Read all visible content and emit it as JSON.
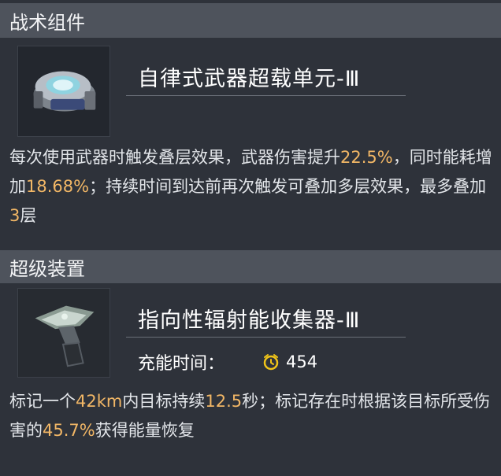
{
  "tactical": {
    "header": "战术组件",
    "item_name": "自律式武器超载单元-Ⅲ",
    "icon": "overload-unit-icon",
    "desc": {
      "p1": "每次使用武器时触发叠层效果，武器伤害提升",
      "v1": "22.5%",
      "p2": "，同时能耗增加",
      "v2": "18.68%",
      "p3": "；持续时间到达前再次触发可叠加多层效果，最多叠加",
      "v3": "3",
      "p4": "层"
    }
  },
  "super": {
    "header": "超级装置",
    "item_name": "指向性辐射能收集器-Ⅲ",
    "icon": "radiation-collector-icon",
    "charge_label": "充能时间：",
    "charge_icon": "clock-icon",
    "charge_value": "454",
    "desc": {
      "p1": "标记一个",
      "v1": "42km",
      "p2": "内目标持续",
      "v2": "12.5",
      "p3": "秒；标记存在时根据该目标所受伤害的",
      "v3": "45.7%",
      "p4": "获得能量恢复"
    }
  },
  "colors": {
    "highlight": "#f2b766",
    "header_bg": "#4e535c",
    "panel_bg": "#2e323a",
    "clock_icon": "#f0c419"
  }
}
